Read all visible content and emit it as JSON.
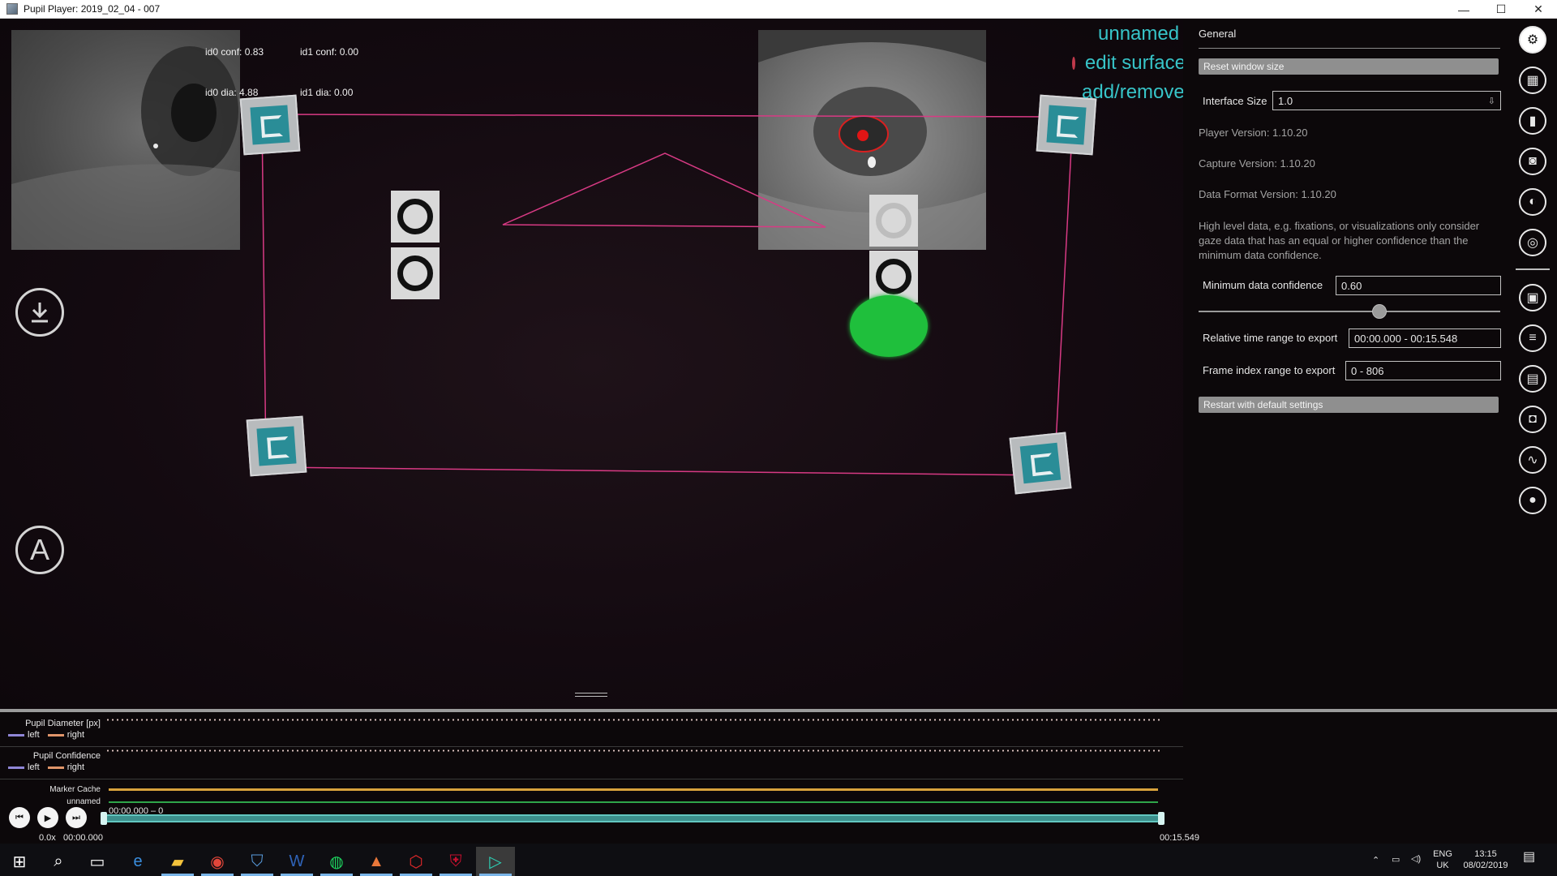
{
  "window": {
    "title": "Pupil Player: 2019_02_04 - 007",
    "minimize": "—",
    "maximize": "☐",
    "close": "✕"
  },
  "eye_overlay": {
    "id0_conf": "id0 conf: 0.83",
    "id1_conf": "id1 conf: 0.00",
    "id0_dia": "id0 dia: 4.88",
    "id1_dia": "id1 dia: 0.00"
  },
  "surface_menu": {
    "name": "unnamed",
    "edit": "edit surface",
    "add_remove": "add/remove markers"
  },
  "side_buttons": {
    "download_icon": "download-icon",
    "annotation_label": "A"
  },
  "panel": {
    "title": "General",
    "reset_window_size": "Reset window size",
    "interface_size_label": "Interface Size",
    "interface_size_value": "1.0",
    "player_version": "Player Version: 1.10.20",
    "capture_version": "Capture Version: 1.10.20",
    "data_format_version": "Data Format Version: 1.10.20",
    "confidence_info": "High level data, e.g. fixations, or visualizations only consider gaze data that has an equal or higher confidence than the minimum data confidence.",
    "min_confidence_label": "Minimum data confidence",
    "min_confidence_value": "0.60",
    "min_confidence_level": 0.6,
    "time_range_label": "Relative time range to export",
    "time_range_value": "00:00.000 - 00:15.548",
    "frame_range_label": "Frame index range to export",
    "frame_range_value": "0 - 806",
    "restart_defaults": "Restart with default settings"
  },
  "iconbar": {
    "items": [
      "gear-icon",
      "grid-icon",
      "bar-chart-icon",
      "camera-icon",
      "eye-icon",
      "target-icon",
      "screen-icon",
      "document-icon",
      "save-icon",
      "capture-icon",
      "line-chart-icon",
      "record-icon"
    ]
  },
  "timeline": {
    "pupil_diameter_label": "Pupil Diameter [px]",
    "pupil_confidence_label": "Pupil Confidence",
    "left": "left",
    "right": "right",
    "marker_cache": "Marker Cache",
    "unnamed": "unnamed",
    "current_time": "00:00.000 – 0",
    "speed": "0.0x",
    "elapsed": "00:00.000",
    "end_time": "00:15.549",
    "left_color": "#8f86d6",
    "right_color": "#e0956a"
  },
  "taskbar": {
    "apps": [
      "windows-start-icon",
      "search-icon",
      "task-view-icon",
      "edge-icon",
      "file-explorer-icon",
      "chrome-icon",
      "defender-icon",
      "word-icon",
      "spotify-icon",
      "matlab-icon",
      "acrobat-icon",
      "mcafee-icon",
      "pupil-player-icon"
    ],
    "lang_top": "ENG",
    "lang_bottom": "UK",
    "time": "13:15",
    "date": "08/02/2019"
  }
}
